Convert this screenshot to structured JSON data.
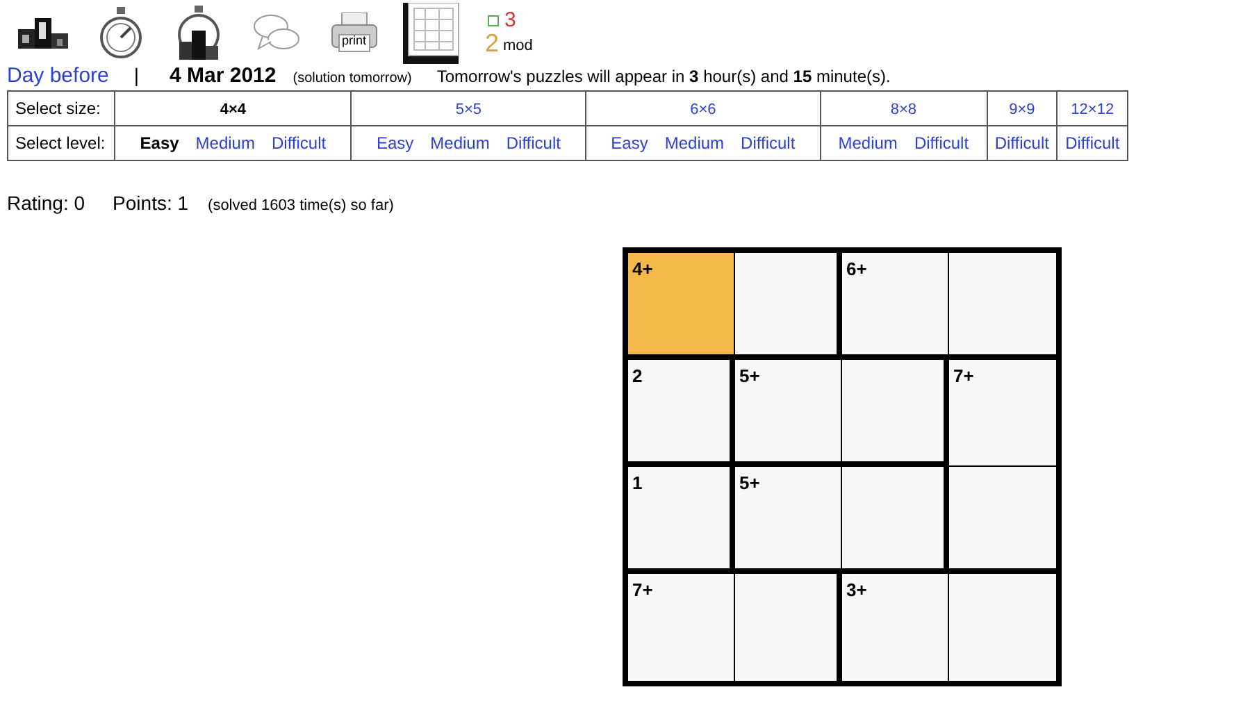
{
  "toolbar": [
    {
      "kind": "podium"
    },
    {
      "kind": "stopwatch"
    },
    {
      "kind": "stopwatch-podium"
    },
    {
      "kind": "bubbles"
    },
    {
      "kind": "printer",
      "label": "print"
    },
    {
      "kind": "book",
      "selected": true
    },
    {
      "kind": "mod",
      "label": "mod",
      "digits": [
        "3",
        "2"
      ]
    }
  ],
  "header": {
    "back_link": "Day before",
    "separator": "|",
    "date": "4 Mar 2012",
    "note": "(solution tomorrow)",
    "countdown": "Tomorrow's puzzles will appear in **3** hour(s) and **15** minute(s)."
  },
  "selector": {
    "size_label": "Select size:",
    "level_label": "Select level:",
    "sizes": [
      {
        "label": "4×4",
        "selected": true,
        "levels": [
          {
            "label": "Easy",
            "selected": true
          },
          {
            "label": "Medium",
            "selected": false
          },
          {
            "label": "Difficult",
            "selected": false
          }
        ]
      },
      {
        "label": "5×5",
        "selected": false,
        "levels": [
          {
            "label": "Easy",
            "selected": false
          },
          {
            "label": "Medium",
            "selected": false
          },
          {
            "label": "Difficult",
            "selected": false
          }
        ]
      },
      {
        "label": "6×6",
        "selected": false,
        "levels": [
          {
            "label": "Easy",
            "selected": false
          },
          {
            "label": "Medium",
            "selected": false
          },
          {
            "label": "Difficult",
            "selected": false
          }
        ]
      },
      {
        "label": "8×8",
        "selected": false,
        "levels": [
          {
            "label": "Medium",
            "selected": false
          },
          {
            "label": "Difficult",
            "selected": false
          }
        ]
      },
      {
        "label": "9×9",
        "selected": false,
        "levels": [
          {
            "label": "Difficult",
            "selected": false
          }
        ]
      },
      {
        "label": "12×12",
        "selected": false,
        "levels": [
          {
            "label": "Difficult",
            "selected": false
          }
        ]
      }
    ]
  },
  "stats": {
    "rating": "Rating: 0",
    "points": "Points: 1",
    "solved": "(solved 1603 time(s) so far)"
  },
  "puzzle": {
    "rows": [
      [
        {
          "clue": "4+",
          "selected": true,
          "wall_right": false,
          "wall_bottom": true
        },
        {
          "selected": false,
          "wall_right": true,
          "wall_bottom": true
        },
        {
          "clue": "6+",
          "selected": false,
          "wall_right": false,
          "wall_bottom": true
        },
        {
          "selected": false,
          "wall_bottom": true
        }
      ],
      [
        {
          "clue": "2",
          "selected": false,
          "wall_right": true,
          "wall_bottom": true
        },
        {
          "clue": "5+",
          "selected": false,
          "wall_right": false,
          "wall_bottom": true
        },
        {
          "selected": false,
          "wall_right": true,
          "wall_bottom": true
        },
        {
          "clue": "7+",
          "selected": false,
          "wall_bottom": false
        }
      ],
      [
        {
          "clue": "1",
          "selected": false,
          "wall_right": true,
          "wall_bottom": true
        },
        {
          "clue": "5+",
          "selected": false,
          "wall_right": false,
          "wall_bottom": true
        },
        {
          "selected": false,
          "wall_right": true,
          "wall_bottom": true
        },
        {
          "selected": false,
          "wall_bottom": true
        }
      ],
      [
        {
          "clue": "7+",
          "selected": false,
          "wall_right": false
        },
        {
          "selected": false,
          "wall_right": true
        },
        {
          "clue": "3+",
          "selected": false,
          "wall_right": false
        },
        {
          "selected": false
        }
      ]
    ]
  }
}
